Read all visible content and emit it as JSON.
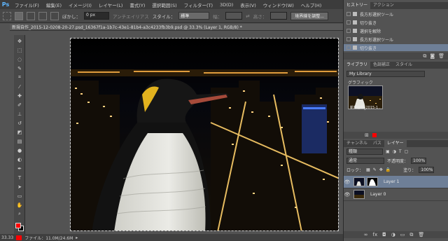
{
  "app": {
    "logo": "Ps"
  },
  "menu": [
    "ファイル(F)",
    "編集(E)",
    "イメージ(I)",
    "レイヤー(L)",
    "書式(Y)",
    "選択範囲(S)",
    "フィルター(T)",
    "3D(D)",
    "表示(V)",
    "ウィンドウ(W)",
    "ヘルプ(H)"
  ],
  "options": {
    "feather_label": "ぼかし：",
    "feather_value": "0 px",
    "antialias_label": "アンチエイリアス",
    "style_label": "スタイル：",
    "style_value": "標準",
    "width_label": "幅：",
    "height_label": "高さ：",
    "refine_button": "境界線を調整..."
  },
  "document": {
    "tab_title": "新規自作_2015-12-0208-20-27.psd_16367f1a-1b7c-43e1-81b4-a3c4233fb3b9.psd @ 33.3% (Layer 1, RGB/8) *"
  },
  "status": {
    "zoom": "33.33",
    "file_info": "ファイル：11.0M/24.6M"
  },
  "colors": {
    "foreground": "#ff0000",
    "background": "#000000",
    "selection": "#6e7f97"
  },
  "history": {
    "tabs": [
      "ヒストリー",
      "アクション"
    ],
    "items": [
      {
        "label": "長方形選択ツール",
        "icon": "marquee-icon",
        "selected": false
      },
      {
        "label": "切り抜き",
        "icon": "crop-icon",
        "selected": false
      },
      {
        "label": "選択を解除",
        "icon": "deselect-icon",
        "selected": false
      },
      {
        "label": "長方形選択ツール",
        "icon": "marquee-icon",
        "selected": false
      },
      {
        "label": "切り抜き",
        "icon": "crop-icon",
        "selected": true
      }
    ]
  },
  "library": {
    "tabs": [
      "ライブラリ",
      "色調補正",
      "スタイル"
    ],
    "selected_library": "My Library",
    "section_label": "グラフィック",
    "thumb_caption": "新規自作_2015-1..."
  },
  "layers": {
    "tabs": [
      "チャンネル",
      "パス",
      "レイヤー"
    ],
    "filter_value": "種類",
    "blend_mode": "通常",
    "opacity_label": "不透明度：",
    "opacity_value": "100%",
    "lock_label": "ロック：",
    "fill_label": "塗り：",
    "fill_value": "100%",
    "items": [
      {
        "name": "Layer 1",
        "selected": true,
        "has_mask": true
      },
      {
        "name": "Layer 0",
        "selected": false,
        "has_mask": false
      }
    ]
  }
}
